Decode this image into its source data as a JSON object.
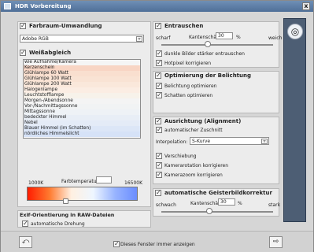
{
  "window": {
    "title": "HDR Vorbereitung",
    "close": "x"
  },
  "farbraum": {
    "title": "Farbraum-Umwandlung",
    "select": "Adobe RGB"
  },
  "weiss": {
    "title": "Weißabgleich",
    "items": [
      "wie Aufnahme/Kamera",
      "Kerzenschein",
      "Glühlampe 60 Watt",
      "Glühlampe 100 Watt",
      "Glühlampe 200 Watt",
      "Halogenlampe",
      "Leuchtstofflampe",
      "Morgen-/Abendsonne",
      "Vor-/Nachmittagssonne",
      "Mittagssonne",
      "bedeckter Himmel",
      "Nebel",
      "Blauer Himmel (im Schatten)",
      "nördliches Himmelslicht"
    ],
    "temp_label": "Farbtemperatur",
    "min": "1000K",
    "max": "16500K"
  },
  "exif": {
    "title": "Exif-Orientierung in RAW-Dateien",
    "option": "automatische Drehung"
  },
  "entrauschen": {
    "title": "Entrauschen",
    "left": "scharf",
    "sharpness_label": "Kantenschärfe",
    "sharpness_value": "30",
    "percent": "%",
    "right": "weich",
    "option1": "dunkle Bilder stärker entrauschen",
    "option2": "Hotpixel korrigieren"
  },
  "belichtung": {
    "title": "Optimierung der Belichtung",
    "option1": "Belichtung optimieren",
    "option2": "Schatten optimieren"
  },
  "ausrichtung": {
    "title": "Ausrichtung (Alignment)",
    "option1": "automatischer Zuschnitt",
    "interp_label": "Interpolation:",
    "interp_value": "S-Kurve",
    "option2": "Verschiebung",
    "option3": "Kamerarotation korrigieren",
    "option4": "Kamerazoom korrigieren"
  },
  "geister": {
    "title": "automatische Geisterbildkorrektur",
    "left": "schwach",
    "sharpness_label": "Kantenschärfe",
    "sharpness_value": "30",
    "percent": "%",
    "right": "stark"
  },
  "bottom": {
    "show_again": "Dieses Fenster immer anzeigen"
  },
  "icons": {
    "title": "hdr-window-icon",
    "sidebar": "help-icon",
    "back": "back-arrow-icon",
    "next": "next-arrow-icon"
  }
}
